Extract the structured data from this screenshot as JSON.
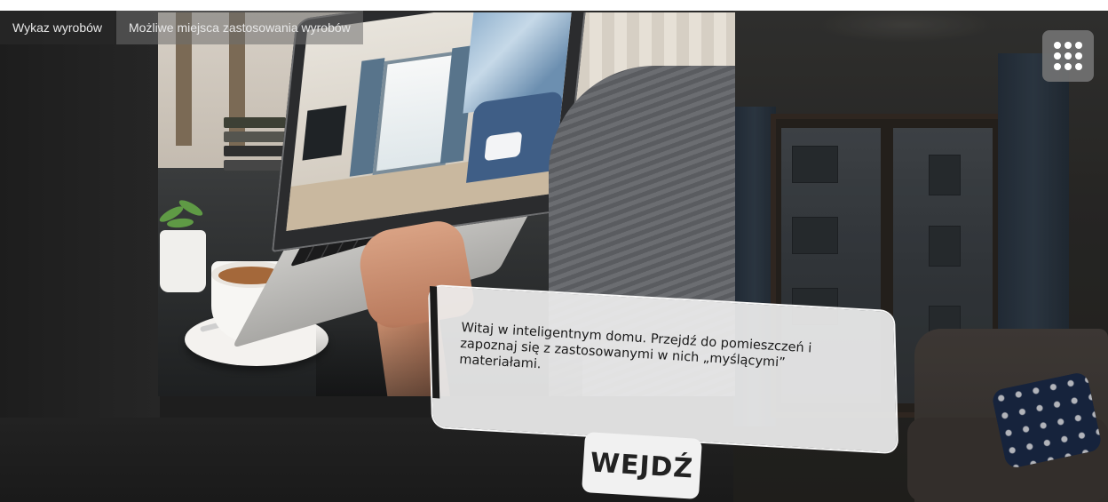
{
  "menu": {
    "items": [
      {
        "label": "Wykaz wyrobów"
      },
      {
        "label": "Możliwe miejsca zastosowania wyrobów"
      }
    ]
  },
  "grid_button": {
    "icon": "grid-dots-icon"
  },
  "welcome": {
    "text": "Witaj w inteligentnym domu. Przejdź do pomieszczeń i zapoznaj się z zastosowanymi w nich „myślącymi” materiałami."
  },
  "enter_button": {
    "label": "WEJDŹ"
  },
  "colors": {
    "panel": "#eeeeee",
    "button": "#f1f1f1",
    "menu_bg": "#282828"
  }
}
